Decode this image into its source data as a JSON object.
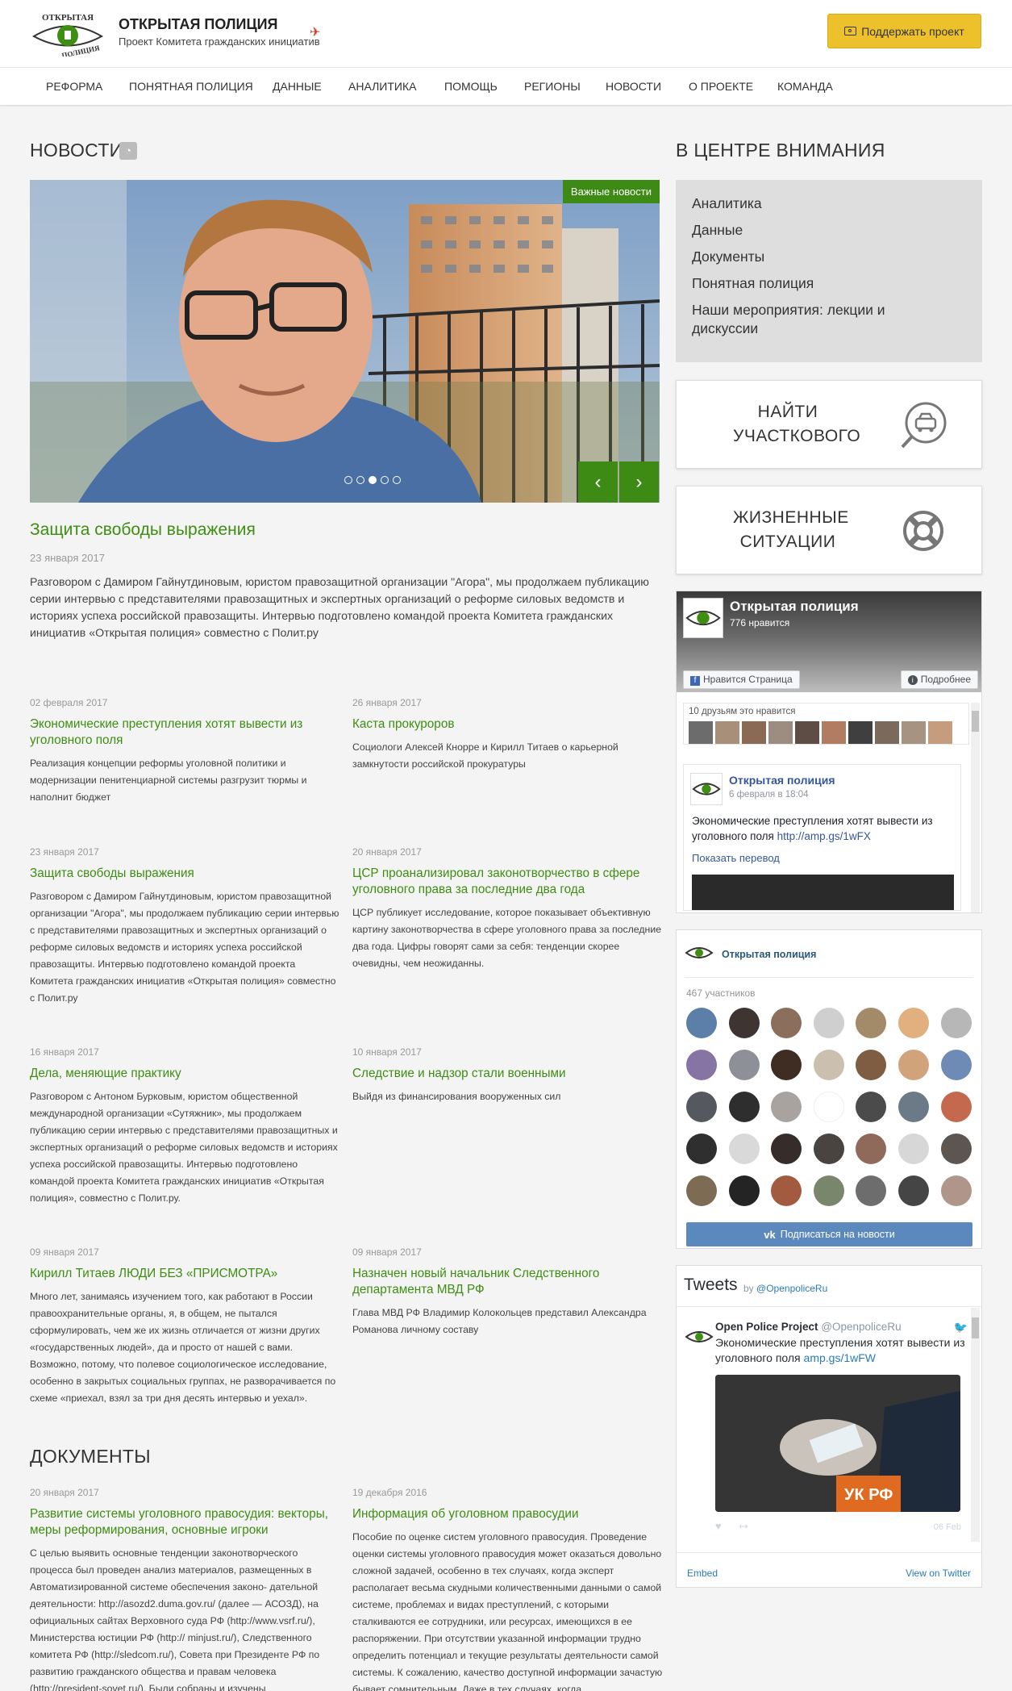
{
  "header": {
    "title": "ОТКРЫТАЯ ПОЛИЦИЯ",
    "subtitle": "Проект Комитета гражданских инициатив",
    "logo_text_top": "ОТКРЫТАЯ",
    "logo_text_bottom": "ПОЛИЦИЯ",
    "support_label": "Поддержать проект"
  },
  "nav": [
    "РЕФОРМА",
    "ПОНЯТНАЯ ПОЛИЦИЯ",
    "ДАННЫЕ",
    "АНАЛИТИКА",
    "ПОМОЩЬ",
    "РЕГИОНЫ",
    "НОВОСТИ",
    "О ПРОЕКТЕ",
    "КОМАНДА"
  ],
  "news": {
    "heading": "НОВОСТИ",
    "badge": "Важные новости",
    "featured": {
      "title": "Защита свободы выражения",
      "date": "23 января 2017",
      "text": "Разговором с Дамиром Гайнутдиновым, юристом правозащитной организации \"Агора\", мы продолжаем публикацию серии интервью с представителями правозащитных и экспертных организаций о реформе силовых ведомств и историях успеха российской правозащиты. Интервью подготовлено командой проекта Комитета гражданских инициатив «Открытая полиция» совместно с Полит.ру"
    },
    "items": [
      {
        "date": "02 февраля 2017",
        "title": "Экономические преступления хотят вывести из уголовного поля",
        "text": "Реализация концепции реформы уголовной политики и модернизации пенитенциарной системы разгрузит тюрмы и наполнит бюджет"
      },
      {
        "date": "26 января 2017",
        "title": "Каста прокуроров",
        "text": "Социологи Алексей Кнорре и Кирилл Титаев о карьерной замкнутости российской прокуратуры"
      },
      {
        "date": "23 января 2017",
        "title": "Защита свободы выражения",
        "text": "Разговором с Дамиром Гайнутдиновым, юристом правозащитной организации \"Агора\", мы продолжаем публикацию серии интервью с представителями правозащитных и экспертных организаций о реформе силовых ведомств и историях успеха российской правозащиты. Интервью подготовлено командой проекта Комитета гражданских инициатив «Открытая полиция» совместно с Полит.ру"
      },
      {
        "date": "20 января 2017",
        "title": "ЦСР проанализировал законотворчество в сфере уголовного права за последние два года",
        "text": "ЦСР публикует исследование, которое показывает объективную картину законотворчества в сфере уголовного права за последние два года. Цифры говорят сами за себя: тенденции скорее очевидны, чем неожиданны."
      },
      {
        "date": "16 января 2017",
        "title": "Дела, меняющие практику",
        "text": "Разговором с Антоном Бурковым, юристом общественной международной организации «Сутяжник», мы продолжаем публикацию серии интервью с представителями правозащитных и экспертных организаций о реформе силовых ведомств и историях успеха российской правозащиты. Интервью подготовлено командой проекта Комитета гражданских инициатив «Открытая полиция», совместно с Полит.ру."
      },
      {
        "date": "10 января 2017",
        "title": "Следствие и надзор стали военными",
        "text": "Выйдя из финансирования вооруженных сил"
      },
      {
        "date": "09 января 2017",
        "title": "Кирилл Титаев ЛЮДИ БЕЗ «ПРИСМОТРА»",
        "text": "Много лет, занимаясь изучением того, как работают в России правоохранительные органы, я, в общем, не пытался сформулировать, чем же их жизнь отличается от жизни других «государственных людей», да и просто от нашей с вами. Возможно, потому, что полевое социологическое исследование, особенно в закрытых социальных группах, не разворачивается по схеме «приехал, взял за три дня десять интервью и уехал»."
      },
      {
        "date": "09 января 2017",
        "title": "Назначен новый начальник Следственного департамента МВД РФ",
        "text": "Глава МВД РФ Владимир Колокольцев представил Александра Романова личному составу"
      }
    ]
  },
  "documents": {
    "heading": "ДОКУМЕНТЫ",
    "items": [
      {
        "date": "20 января 2017",
        "title": "Развитие системы уголовного правосудия: векторы, меры реформирования, основные игроки",
        "text": "С целью выявить основные тенденции законотворческого процесса был проведен анализ материалов, размещенных в Автоматизированной системе обеспечения законо- дательной деятельности: http://asozd2.duma.gov.ru/ (далее — АСОЗД), на официальных сайтах Верховного суда РФ (http://www.vsrf.ru/), Министерства юстиции РФ (http:// minjust.ru/), Следственного комитета РФ (http://sledcom.ru/), Совета при Президенте РФ по развитию гражданского общества и правам человека (http://president-sovet.ru/). Были собраны и изучены"
      },
      {
        "date": "19 декабря 2016",
        "title": "Информация об уголовном правосудии",
        "text": "Пособие по оценке систем уголовного правосудия. Проведение оценки системы уголовного правосудия может оказаться довольно сложной задачей, особенно в тех случаях, когда эксперт располагает весьма скудными количественными данными о самой системе, проблемах и видах преступлений, с которыми сталкиваются ее сотрудники, или ресурсах, имеющихся в ее распоряжении. При отсутствии указанной информации трудно определить потенциал и текущие результаты деятельности самой системы. К сожалению, качество доступной информации зачастую бывает сомнительным. Даже в тех случаях, когда"
      }
    ]
  },
  "sidebar": {
    "heading": "В ЦЕНТРЕ ВНИМАНИЯ",
    "links": [
      "Аналитика",
      "Данные",
      "Документы",
      "Понятная полиция",
      "Наши мероприятия: лекции и дискуссии"
    ],
    "card_find": "НАЙТИ УЧАСТКОВОГО",
    "card_life": "ЖИЗНЕННЫЕ СИТУАЦИИ"
  },
  "facebook": {
    "page": "Открытая полиция",
    "likes": "776 нравится",
    "like_btn": "Нравится Страница",
    "more_btn": "Подробнее",
    "friends": "10 друзьям это нравится",
    "post_author": "Открытая полиция",
    "post_date": "6 февраля в 18:04",
    "post_text": "Экономические преступления хотят вывести из уголовного поля",
    "post_link": "http://amp.gs/1wFX",
    "translate": "Показать перевод"
  },
  "vk": {
    "group": "Открытая полиция",
    "members": "467 участников",
    "subscribe": "Подписаться на новости"
  },
  "twitter": {
    "title": "Tweets",
    "by": "by",
    "handle": "@OpenpoliceRu",
    "tweet_author": "Open Police Project",
    "tweet_handle": "@OpenpoliceRu",
    "tweet_text": "Экономические преступления хотят вывести из уголовного поля",
    "tweet_link": "amp.gs/1wFW",
    "tweet_date": "06 Feb",
    "embed": "Embed",
    "view": "View on Twitter",
    "photo_stamp": "УК РФ"
  }
}
